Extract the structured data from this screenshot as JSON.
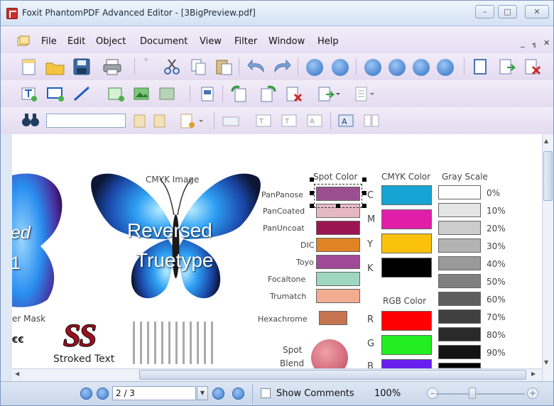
{
  "window": {
    "title": "Foxit PhantomPDF Advanced Editor - [3BigPreview.pdf]",
    "controls": [
      "–",
      "□",
      "✕"
    ]
  },
  "menubar": {
    "items": [
      "File",
      "Edit",
      "Object",
      "Document",
      "View",
      "Filter",
      "Window",
      "Help"
    ],
    "doc_controls": [
      "_",
      "ร",
      "✕"
    ]
  },
  "document": {
    "image_caption": "CMYK Image",
    "reversed_line1": "Reversed",
    "reversed_line2": "Truetype",
    "partial_ed": "ed",
    "partial_1": "1",
    "partial_mask": "er Mask",
    "partial_ee": "€€",
    "ss_logo": "SS",
    "stroked_text": "Stroked Text",
    "spot_color_header": "Spot Color",
    "cmyk_color_header": "CMYK Color",
    "gray_scale_header": "Gray Scale",
    "rgb_color_header": "RGB Color",
    "spot_labels": [
      "PanPanose",
      "PanCoated",
      "PanUncoat",
      "DIC",
      "Toyo",
      "Focaltone",
      "Trumatch",
      "Hexachrome"
    ],
    "spot_colors": [
      "#9b4f8f",
      "#e6b8c6",
      "#9a1552",
      "#e08424",
      "#a04a97",
      "#9ed6c0",
      "#f2ad91",
      "#c6744f"
    ],
    "cmyk_labels": [
      "C",
      "M",
      "Y",
      "K"
    ],
    "cmyk_colors": [
      "#16a4d4",
      "#e01ea8",
      "#fbc20c",
      "#000000"
    ],
    "rgb_labels": [
      "R",
      "G",
      "B"
    ],
    "rgb_colors": [
      "#ff0000",
      "#22ee22",
      "#6620ee"
    ],
    "gray_labels": [
      "0%",
      "10%",
      "20%",
      "30%",
      "40%",
      "50%",
      "60%",
      "70%",
      "80%",
      "90%"
    ],
    "gray_colors": [
      "#ffffff",
      "#e6e6e6",
      "#cccccc",
      "#b3b3b3",
      "#999999",
      "#808080",
      "#5e5e5e",
      "#404040",
      "#2a2a2a",
      "#141414"
    ],
    "spot_blend_line1": "Spot",
    "spot_blend_line2": "Blend"
  },
  "statusbar": {
    "page_value": "2 / 3",
    "show_comments": "Show Comments",
    "zoom": "100%",
    "zoom_minus": "–",
    "zoom_plus": "+"
  },
  "colors": {
    "menubar_bg": "#ece4f5",
    "titlebar_bg": "#dde8f6",
    "accent_blue": "#3f7fd0",
    "foxit_red": "#c8302c"
  }
}
